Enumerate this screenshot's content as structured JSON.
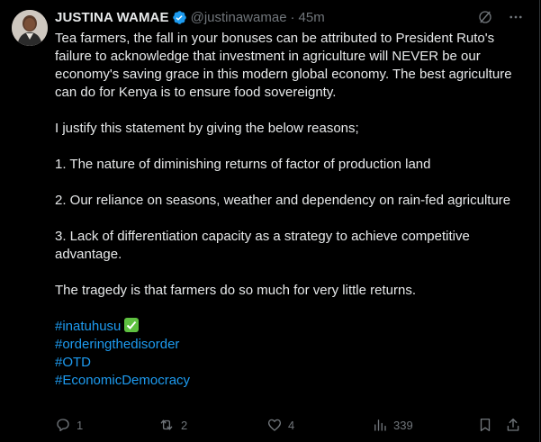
{
  "tweet": {
    "author": {
      "display_name": "JUSTINA WAMAE",
      "handle": "@justinawamae",
      "separator": "·",
      "time": "45m"
    },
    "paragraphs": [
      "Tea farmers, the fall in your bonuses can be attributed to President Ruto's failure to acknowledge that investment in agriculture will NEVER be our economy's saving grace in this modern global economy. The best agriculture can do for Kenya is to ensure food sovereignty.",
      "I justify this statement by giving the below reasons;",
      "1. The nature of diminishing returns of factor of production land",
      "2. Our reliance on seasons, weather and dependency on rain-fed agriculture",
      "3. Lack of differentiation capacity as a strategy to achieve competitive advantage.",
      "The tragedy is that farmers do so much for very little returns."
    ],
    "hashtags": [
      "#inatuhusu",
      "#orderingthedisorder",
      "#OTD",
      "#EconomicDemocracy"
    ],
    "actions": {
      "replies": "1",
      "reposts": "2",
      "likes": "4",
      "views": "339"
    }
  },
  "icons": {
    "verified": "verified-badge-icon",
    "grok": "grok-icon",
    "more": "more-icon",
    "reply": "reply-icon",
    "repost": "repost-icon",
    "like": "like-icon",
    "views": "views-icon",
    "bookmark": "bookmark-icon",
    "share": "share-icon",
    "checkmark": "check-mark-emoji"
  },
  "colors": {
    "background": "#000000",
    "text": "#e7e9ea",
    "muted": "#71767b",
    "link": "#1d9bf0",
    "verified": "#1d9bf0"
  }
}
